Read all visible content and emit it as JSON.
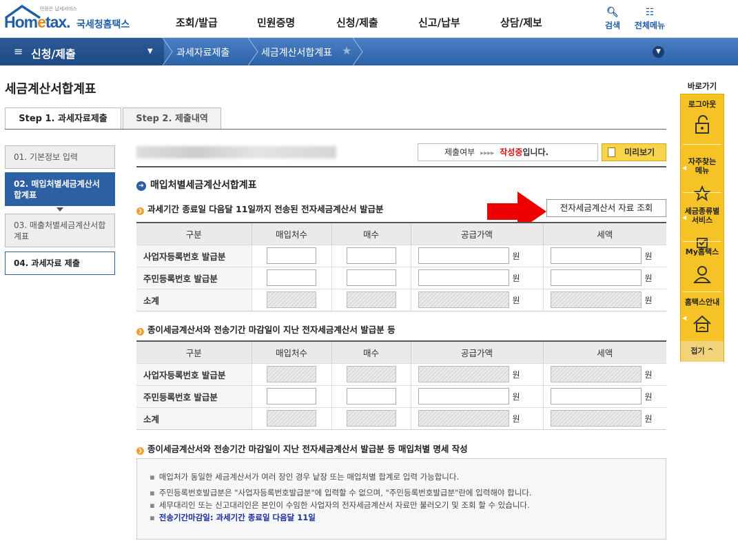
{
  "header": {
    "logo_small": "민원은 납세서비스",
    "logo_main_a": "Hom",
    "logo_main_e": "e",
    "logo_main_b": "tax.",
    "logo_kr": "국세청홈택스",
    "nav": [
      "조회/발급",
      "민원증명",
      "신청/제출",
      "신고/납부",
      "상담/제보"
    ],
    "search_label": "검색",
    "menu_label": "전체메뉴",
    "brand_color": "#1f5fa8"
  },
  "breadcrumb": {
    "menu": "신청/제출",
    "items": [
      "과세자료제출",
      "세금계산서합계표"
    ]
  },
  "page_title": "세금계산서합계표",
  "tabs": [
    "Step 1. 과세자료제출",
    "Step 2. 제출내역"
  ],
  "steps": [
    "01. 기본정보 입력",
    "02. 매입처별세금계산서합계표",
    "03. 매출처별세금계산서합계표",
    "04. 과세자료 제출"
  ],
  "status": {
    "label": "제출여부",
    "arrows": "▸▸▸▸",
    "state": "작성중",
    "suffix": "입니다."
  },
  "preview_label": "미리보기",
  "section_title": "매입처별세금계산서합계표",
  "sub1": "과세기간 종료일 다음달 11일까지 전송된 전자세금계산서 발급분",
  "query_button": "전자세금계산서 자료 조회",
  "sub2": "종이세금계산서와 전송기간 마감일이 지난 전자세금계산서 발급분 등",
  "sub3": "종이세금계산서와 전송기간 마감일이 지난 전자세금계산서 발급분 등 매입처별 명세 작성",
  "table": {
    "headers": [
      "구분",
      "매입처수",
      "매수",
      "공급가액",
      "세액"
    ],
    "rows": [
      "사업자등록번호 발급분",
      "주민등록번호 발급분",
      "소계"
    ],
    "unit": "원"
  },
  "notices": [
    "매입처가 동일한 세금계산서가 여러 장인 경우 낱장 또는 매입처별 합계로 입력 가능합니다.",
    "주민등록번호발급분은 \"사업자등록번호발급분\"에 입력할 수 없으며, \"주민등록번호발급분\"란에 입력해야 합니다.",
    "세무대리인 또는 신고대리인은 본인이 수임한 사업자의 전자세금계산서 자료만 불러오기 및 조회 할 수 있습니다.",
    "전송기간마감일: 과세기간 종료일 다음달 11일"
  ],
  "quick": {
    "head": "바로가기",
    "items": [
      "로그아웃",
      "자주찾는\n메뉴",
      "세금종류별\n서비스",
      "My홈택스",
      "홈택스안내"
    ],
    "fold": "접기 ^"
  }
}
